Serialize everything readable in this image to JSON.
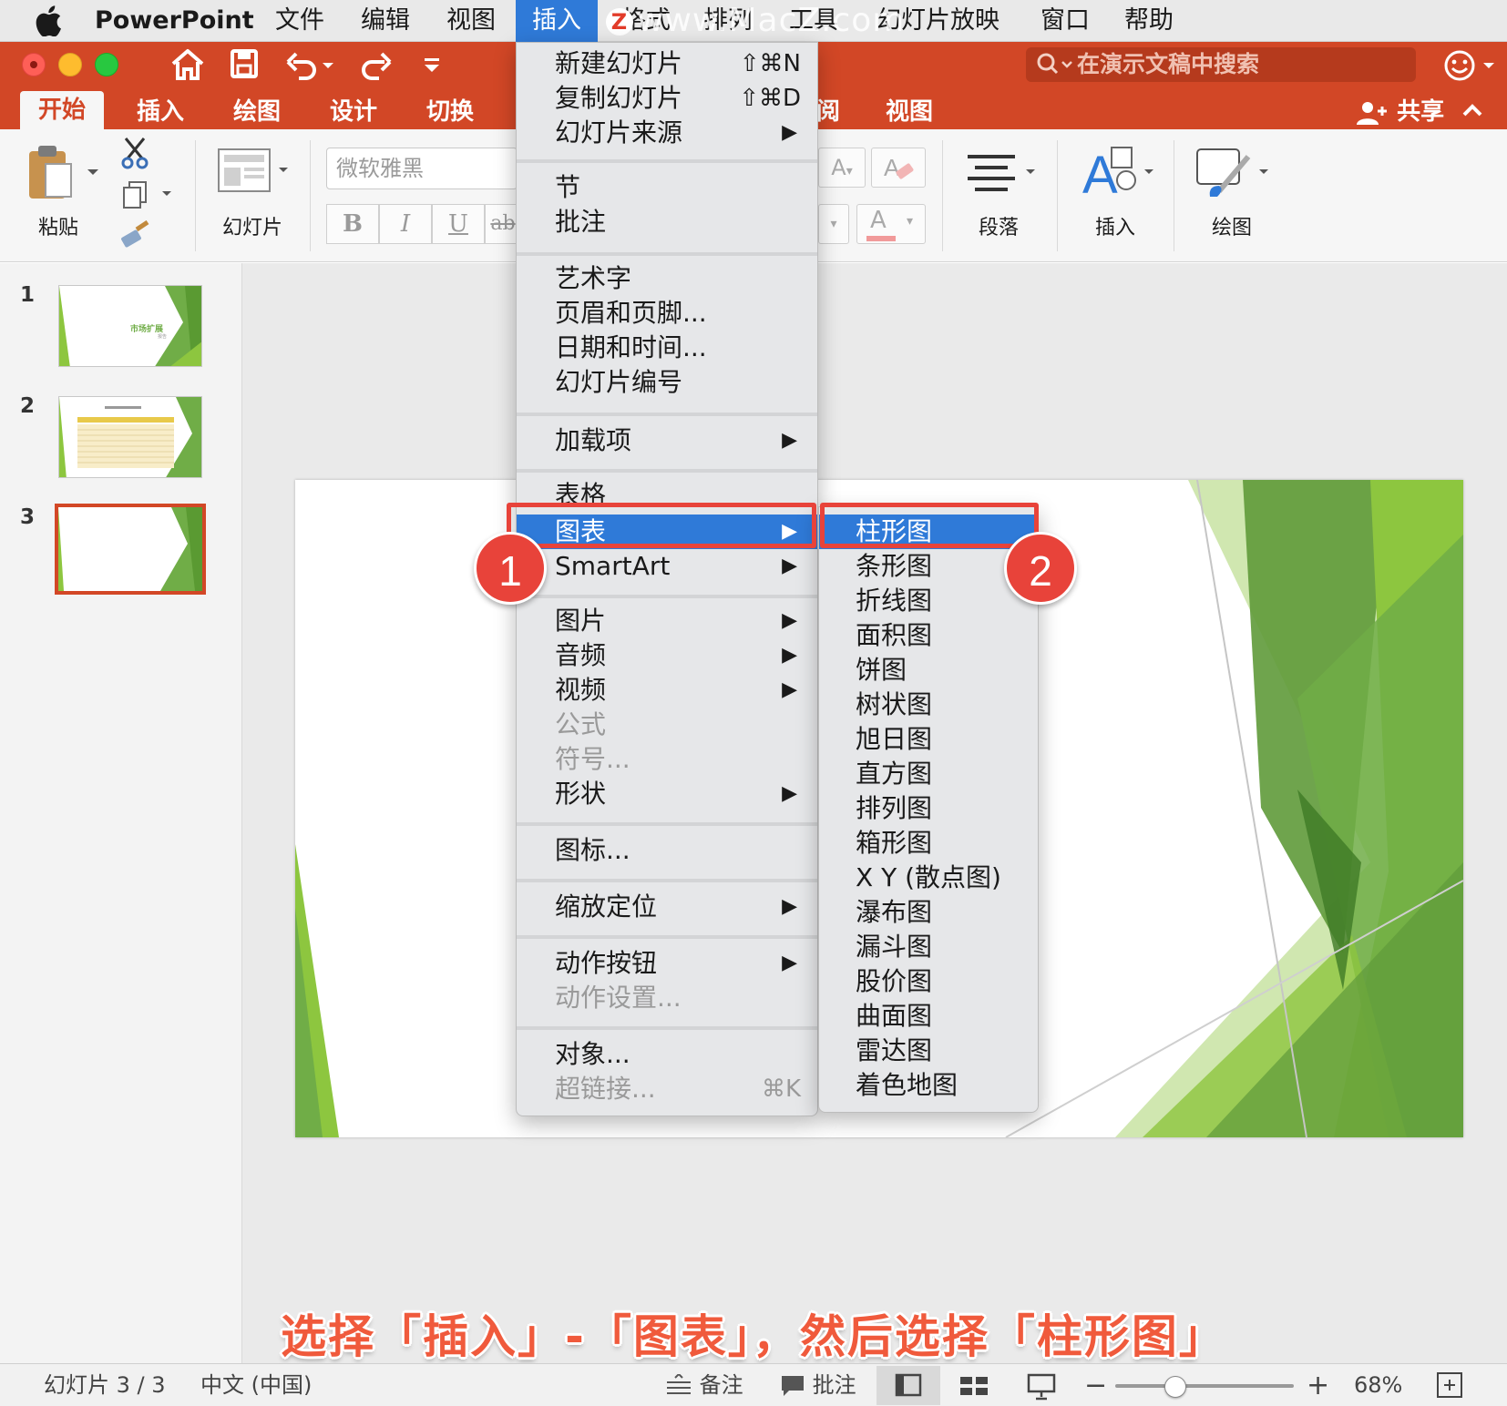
{
  "menubar": {
    "app_name": "PowerPoint",
    "items": [
      "文件",
      "编辑",
      "视图",
      "插入",
      "格式",
      "排列",
      "工具",
      "幻灯片放映",
      "窗口",
      "帮助"
    ],
    "active": "插入",
    "watermark": "www.MacZ.com",
    "watermark_logo": "Z"
  },
  "toolbar": {
    "search_placeholder": "在演示文稿中搜索",
    "tabs": [
      "开始",
      "插入",
      "绘图",
      "设计",
      "切换",
      "阅",
      "视图"
    ],
    "active_tab": "开始",
    "share_label": "共享"
  },
  "ribbon": {
    "paste_label": "粘贴",
    "slides_label": "幻灯片",
    "font_name": "微软雅黑",
    "bold": "B",
    "italic": "I",
    "underline": "U",
    "strike": "ab",
    "font_grow": "A",
    "font_color": "A",
    "paragraph_label": "段落",
    "insert_label": "插入",
    "draw_label": "绘图"
  },
  "thumbnails": [
    {
      "num": "1",
      "title": "市场扩展",
      "subtitle": "报告"
    },
    {
      "num": "2"
    },
    {
      "num": "3"
    }
  ],
  "insert_menu": {
    "items": [
      {
        "label": "新建幻灯片",
        "shortcut": "⇧⌘N"
      },
      {
        "label": "复制幻灯片",
        "shortcut": "⇧⌘D"
      },
      {
        "label": "幻灯片来源",
        "submenu": true
      },
      {
        "label": "节"
      },
      {
        "label": "批注"
      },
      {
        "label": "艺术字"
      },
      {
        "label": "页眉和页脚..."
      },
      {
        "label": "日期和时间..."
      },
      {
        "label": "幻灯片编号"
      },
      {
        "label": "加载项",
        "submenu": true
      },
      {
        "label": "表格"
      },
      {
        "label": "图表",
        "submenu": true,
        "highlighted": true
      },
      {
        "label": "SmartArt",
        "submenu": true
      },
      {
        "label": "图片",
        "submenu": true
      },
      {
        "label": "音频",
        "submenu": true
      },
      {
        "label": "视频",
        "submenu": true
      },
      {
        "label": "公式",
        "disabled": true
      },
      {
        "label": "符号...",
        "disabled": true
      },
      {
        "label": "形状",
        "submenu": true
      },
      {
        "label": "图标..."
      },
      {
        "label": "缩放定位",
        "submenu": true
      },
      {
        "label": "动作按钮",
        "submenu": true
      },
      {
        "label": "动作设置...",
        "disabled": true
      },
      {
        "label": "对象..."
      },
      {
        "label": "超链接...",
        "shortcut": "⌘K",
        "disabled": true
      }
    ]
  },
  "chart_submenu": {
    "items": [
      "柱形图",
      "条形图",
      "折线图",
      "面积图",
      "饼图",
      "树状图",
      "旭日图",
      "直方图",
      "排列图",
      "箱形图",
      "X Y (散点图)",
      "瀑布图",
      "漏斗图",
      "股价图",
      "曲面图",
      "雷达图",
      "着色地图"
    ],
    "highlighted": "柱形图"
  },
  "callouts": [
    "1",
    "2"
  ],
  "caption": "选择「插入」-「图表」，然后选择「柱形图」",
  "statusbar": {
    "slide_info": "幻灯片 3 / 3",
    "language": "中文 (中国)",
    "notes_label": "备注",
    "comments_label": "批注",
    "zoom_value": "68%",
    "zoom_minus": "−",
    "zoom_plus": "+"
  },
  "colors": {
    "accent": "#d24726",
    "menu_highlight": "#2f7ad8",
    "callout": "#e8433a",
    "slide_green": "#70ad47"
  }
}
